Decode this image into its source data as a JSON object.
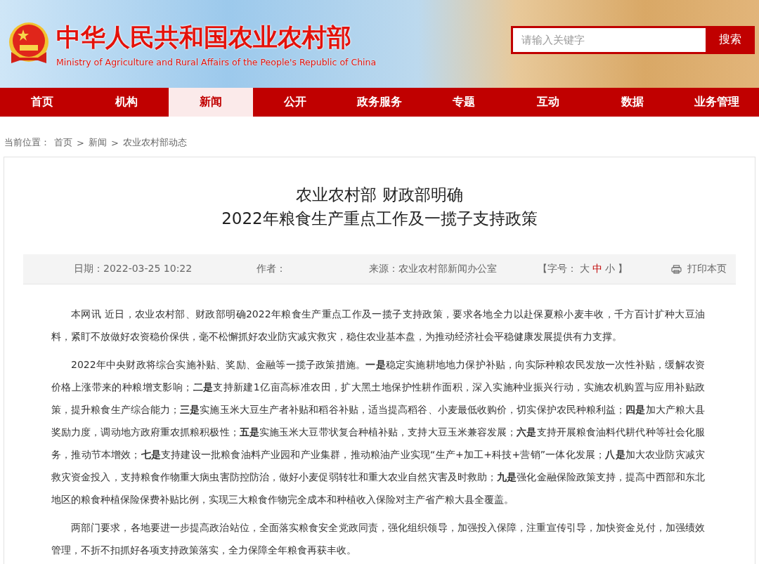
{
  "header": {
    "title": "中华人民共和国农业农村部",
    "subtitle": "Ministry of Agriculture and Rural Affairs of the People's Republic of China",
    "search": {
      "placeholder": "请输入关键字",
      "button": "搜索"
    }
  },
  "nav": [
    {
      "label": "首页",
      "selected": false
    },
    {
      "label": "机构",
      "selected": false
    },
    {
      "label": "新闻",
      "selected": true
    },
    {
      "label": "公开",
      "selected": false
    },
    {
      "label": "政务服务",
      "selected": false
    },
    {
      "label": "专题",
      "selected": false
    },
    {
      "label": "互动",
      "selected": false
    },
    {
      "label": "数据",
      "selected": false
    },
    {
      "label": "业务管理",
      "selected": false
    }
  ],
  "breadcrumb": {
    "label": "当前位置：",
    "items": [
      "首页",
      "新闻",
      "农业农村部动态"
    ],
    "separator": ">"
  },
  "article": {
    "title_lines": [
      "农业农村部 财政部明确",
      "2022年粮食生产重点工作及一揽子支持政策"
    ],
    "meta": {
      "date": "日期：2022-03-25 10:22",
      "author": "作者：",
      "source": "来源：农业农村部新闻办公室",
      "font_size_open": "【字号：",
      "font_sizes": [
        {
          "label": "大",
          "selected": false
        },
        {
          "label": "中",
          "selected": true
        },
        {
          "label": "小",
          "selected": false
        }
      ],
      "font_size_close": "】",
      "print": "打印本页"
    },
    "paragraphs": [
      "本网讯 近日，农业农村部、财政部明确2022年粮食生产重点工作及一揽子支持政策，要求各地全力以赴保夏粮小麦丰收，千方百计扩种大豆油料，紧盯不放做好农资稳价保供，毫不松懈抓好农业防灾减灾救灾，稳住农业基本盘，为推动经济社会平稳健康发展提供有力支撑。",
      "2022年中央财政将综合实施补贴、奖励、金融等一揽子政策措施。**一是**稳定实施耕地地力保护补贴，向实际种粮农民发放一次性补贴，缓解农资价格上涨带来的种粮增支影响；**二是**支持新建1亿亩高标准农田，扩大黑土地保护性耕作面积，深入实施种业振兴行动，实施农机购置与应用补贴政策，提升粮食生产综合能力；**三是**实施玉米大豆生产者补贴和稻谷补贴，适当提高稻谷、小麦最低收购价，切实保护农民种粮利益；**四是**加大产粮大县奖励力度，调动地方政府重农抓粮积极性；**五是**实施玉米大豆带状复合种植补贴，支持大豆玉米兼容发展；**六是**支持开展粮食油料代耕代种等社会化服务，推动节本增效；**七是**支持建设一批粮食油料产业园和产业集群，推动粮油产业实现“生产+加工+科技+营销”一体化发展；**八是**加大农业防灾减灾救灾资金投入，支持粮食作物重大病虫害防控防治，做好小麦促弱转壮和重大农业自然灾害及时救助；**九是**强化金融保险政策支持，提高中西部和东北地区的粮食种植保险保费补贴比例，实现三大粮食作物完全成本和种植收入保险对主产省产粮大县全覆盖。",
      "两部门要求，各地要进一步提高政治站位，全面落实粮食安全党政同责，强化组织领导，加强投入保障，注重宣传引导，加快资金兑付，加强绩效管理，不折不扣抓好各项支持政策落实，全力保障全年粮食再获丰收。"
    ]
  }
}
